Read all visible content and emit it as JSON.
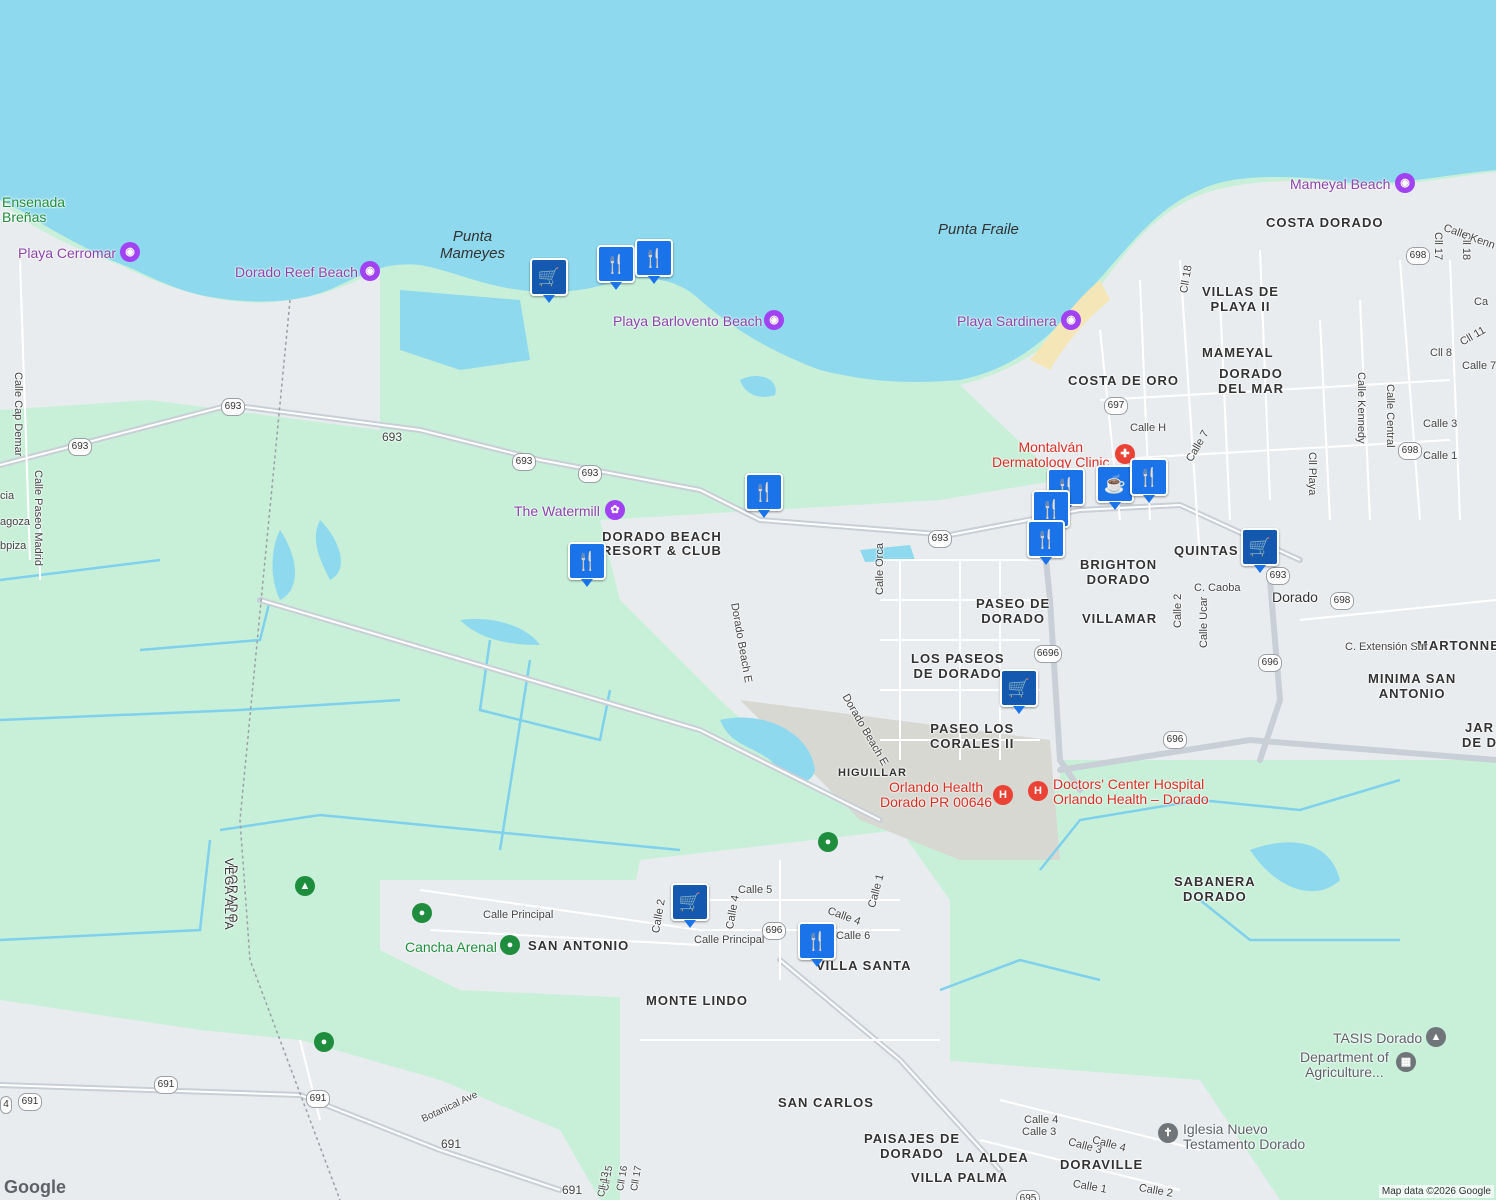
{
  "map": {
    "colors": {
      "water": "#8fd9ee",
      "green": "#c8f0d9",
      "land": "#e9ecef",
      "road": "#ffffff",
      "highway": "#c9cfd6",
      "pin": "#1a73e8"
    },
    "point_labels": [
      {
        "id": "punta-mameyes",
        "lines": [
          "Punta",
          "Mameyes"
        ]
      },
      {
        "id": "punta-fraile",
        "lines": [
          "Punta Fraile"
        ]
      }
    ],
    "areas": [
      {
        "id": "dorado-beach-resort",
        "text": "DORADO BEACH\nRESORT & CLUB"
      },
      {
        "id": "costa-dorado",
        "text": "COSTA DORADO"
      },
      {
        "id": "villas-de-playa",
        "text": "VILLAS DE\nPLAYA II"
      },
      {
        "id": "mameyal",
        "text": "MAMEYAL"
      },
      {
        "id": "costa-de-oro",
        "text": "COSTA DE ORO"
      },
      {
        "id": "dorado-del-mar",
        "text": "DORADO\nDEL MAR"
      },
      {
        "id": "brighton-dorado",
        "text": "BRIGHTON\nDORADO"
      },
      {
        "id": "quintas",
        "text": "QUINTAS"
      },
      {
        "id": "dorado",
        "text": "Dorado"
      },
      {
        "id": "paseo-de-dorado",
        "text": "PASEO DE\nDORADO"
      },
      {
        "id": "villamar",
        "text": "VILLAMAR"
      },
      {
        "id": "los-paseos",
        "text": "LOS PASEOS\nDE DORADO"
      },
      {
        "id": "martonne",
        "text": "MARTONNE"
      },
      {
        "id": "minima-san-antonio",
        "text": "MINIMA SAN\nANTONIO"
      },
      {
        "id": "jar",
        "text": "JAR\nDE D"
      },
      {
        "id": "paseo-los-corales",
        "text": "PASEO LOS\nCORALES II"
      },
      {
        "id": "higuillar",
        "text": "HIGUILLAR"
      },
      {
        "id": "sabanera-dorado",
        "text": "SABANERA\nDORADO"
      },
      {
        "id": "san-antonio",
        "text": "SAN ANTONIO"
      },
      {
        "id": "villa-santa",
        "text": "VILLA SANTA"
      },
      {
        "id": "monte-lindo",
        "text": "MONTE LINDO"
      },
      {
        "id": "san-carlos",
        "text": "SAN CARLOS"
      },
      {
        "id": "paisajes-de-dorado",
        "text": "PAISAJES DE\nDORADO"
      },
      {
        "id": "la-aldea",
        "text": "LA ALDEA"
      },
      {
        "id": "doraville",
        "text": "DORAVILLE"
      },
      {
        "id": "villa-palma",
        "text": "VILLA PALMA"
      },
      {
        "id": "dorado-boundary",
        "text": "DORADO"
      },
      {
        "id": "vega-alta-boundary",
        "text": "VEGA ALTA"
      }
    ],
    "pois": [
      {
        "id": "playa-cerromar",
        "text": "Playa Cerromar",
        "kind": "purple",
        "glyph": "◉"
      },
      {
        "id": "dorado-reef-beach",
        "text": "Dorado Reef Beach",
        "kind": "purple",
        "glyph": "◉"
      },
      {
        "id": "playa-barlovento",
        "text": "Playa Barlovento Beach",
        "kind": "purple",
        "glyph": "◉"
      },
      {
        "id": "playa-sardinera",
        "text": "Playa Sardinera",
        "kind": "purple",
        "glyph": "◉"
      },
      {
        "id": "mameyal-beach",
        "text": "Mameyal Beach",
        "kind": "purple",
        "glyph": "◉"
      },
      {
        "id": "the-watermill",
        "text": "The Watermill",
        "kind": "purple",
        "glyph": "✿"
      },
      {
        "id": "montalvan",
        "text": "Montalván\nDermatology Clinic",
        "kind": "red",
        "glyph": "✚"
      },
      {
        "id": "orlando-health",
        "text": "Orlando Health\nDorado PR 00646",
        "kind": "red",
        "glyph": "H"
      },
      {
        "id": "doctors-center",
        "text": "Doctors' Center Hospital\nOrlando Health – Dorado",
        "kind": "red",
        "glyph": "H"
      },
      {
        "id": "tasis-dorado",
        "text": "TASIS Dorado",
        "kind": "gray",
        "glyph": "▲"
      },
      {
        "id": "dept-agriculture",
        "text": "Department of\nAgriculture...",
        "kind": "gray",
        "glyph": "▦"
      },
      {
        "id": "iglesia",
        "text": "Iglesia Nuevo\nTestamento Dorado",
        "kind": "gray",
        "glyph": "✝"
      },
      {
        "id": "cancha-arenal",
        "text": "Cancha Arenal",
        "kind": "green",
        "glyph": "●"
      },
      {
        "id": "ensenada-brenas",
        "text": "Ensenada\nBreñas",
        "kind": "green",
        "glyph": ""
      }
    ],
    "streets": [
      {
        "id": "calle-cap-demar",
        "text": "Calle Cap Demar"
      },
      {
        "id": "calle-paseo-madrid",
        "text": "Calle Paseo Madrid"
      },
      {
        "id": "cia",
        "text": "cia"
      },
      {
        "id": "agoza",
        "text": "agoza"
      },
      {
        "id": "bpiza",
        "text": "bpiza"
      },
      {
        "id": "dorado-beach-e-1",
        "text": "Dorado Beach E"
      },
      {
        "id": "dorado-beach-e-2",
        "text": "Dorado Beach E"
      },
      {
        "id": "calle-orca",
        "text": "Calle Orca"
      },
      {
        "id": "cll-18",
        "text": "Cll 18"
      },
      {
        "id": "calle-h",
        "text": "Calle H"
      },
      {
        "id": "calle-7",
        "text": "Calle 7"
      },
      {
        "id": "calle-kennedy-1",
        "text": "Calle Kennedy"
      },
      {
        "id": "calle-central",
        "text": "Calle Central"
      },
      {
        "id": "cll-playa",
        "text": "Cll Playa"
      },
      {
        "id": "cll-17",
        "text": "Cll 17"
      },
      {
        "id": "cll-18b",
        "text": "Cll 18"
      },
      {
        "id": "calle-kenn-top",
        "text": "Calle Kenn"
      },
      {
        "id": "calle-3",
        "text": "Calle 3"
      },
      {
        "id": "calle-1",
        "text": "Calle 1"
      },
      {
        "id": "cll-8",
        "text": "Cll 8"
      },
      {
        "id": "cll-11",
        "text": "Cll 11"
      },
      {
        "id": "calle-7b",
        "text": "Calle 7"
      },
      {
        "id": "ca-top",
        "text": "Ca"
      },
      {
        "id": "c-caoba",
        "text": "C. Caoba"
      },
      {
        "id": "calle-2",
        "text": "Calle 2"
      },
      {
        "id": "calle-ucar",
        "text": "Calle Ucar"
      },
      {
        "id": "c-extension-sur",
        "text": "C. Extensión Sur"
      },
      {
        "id": "calle-principal-1",
        "text": "Calle Principal"
      },
      {
        "id": "calle-principal-2",
        "text": "Calle Principal"
      },
      {
        "id": "calle-2b",
        "text": "Calle 2"
      },
      {
        "id": "calle-4",
        "text": "Calle 4"
      },
      {
        "id": "calle-5",
        "text": "Calle 5"
      },
      {
        "id": "calle-4b",
        "text": "Calle 4"
      },
      {
        "id": "calle-1b",
        "text": "Calle 1"
      },
      {
        "id": "calle-6",
        "text": "Calle 6"
      },
      {
        "id": "botanical-ave",
        "text": "Botanical Ave"
      },
      {
        "id": "cll-15",
        "text": "Cll 15"
      },
      {
        "id": "cll-16",
        "text": "Cll 16"
      },
      {
        "id": "cll-17b",
        "text": "Cll 17"
      },
      {
        "id": "cll-13",
        "text": "Cll 13"
      },
      {
        "id": "calle-4c",
        "text": "Calle 4"
      },
      {
        "id": "calle-3b",
        "text": "Calle 3"
      },
      {
        "id": "calle-3c",
        "text": "Calle 3"
      },
      {
        "id": "calle-4d",
        "text": "Calle 4"
      },
      {
        "id": "calle-1c",
        "text": "Calle 1"
      },
      {
        "id": "calle-2c",
        "text": "Calle 2"
      },
      {
        "id": "693-road",
        "text": "693"
      },
      {
        "id": "691-road",
        "text": "691"
      },
      {
        "id": "691-road-2",
        "text": "691"
      }
    ],
    "shields": [
      "693",
      "693",
      "693",
      "693",
      "693",
      "697",
      "698",
      "698",
      "693",
      "698",
      "696",
      "6696",
      "696",
      "696",
      "691",
      "691",
      "695",
      "693",
      "4"
    ],
    "pins": [
      "store",
      "food",
      "food",
      "food",
      "food",
      "food",
      "food",
      "cafe",
      "food",
      "store",
      "store",
      "store",
      "food"
    ],
    "footer": {
      "credit": "Map data ©2026 Google",
      "logo": "Google"
    }
  }
}
